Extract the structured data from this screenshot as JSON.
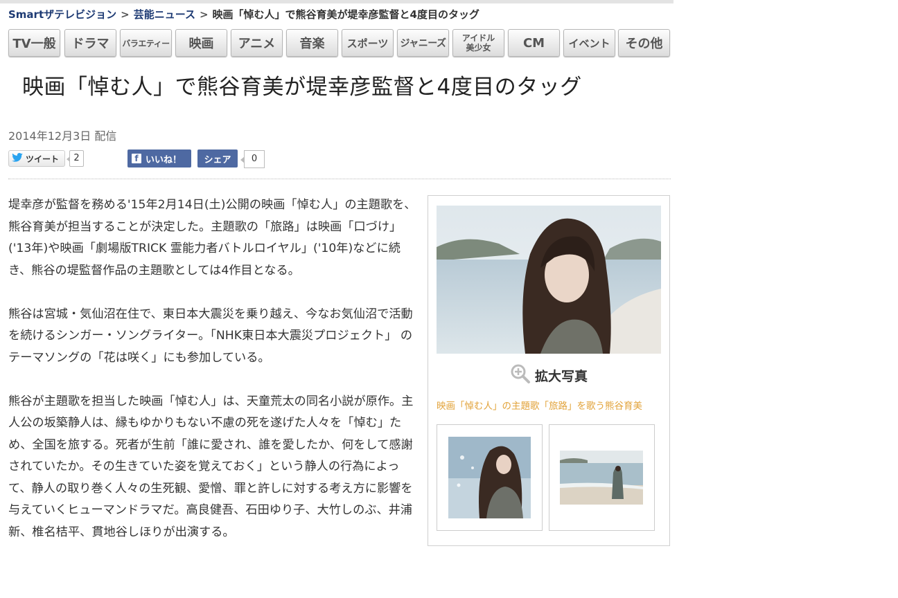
{
  "breadcrumb": {
    "site": "Smartザテレビジョン",
    "separator": ">",
    "category": "芸能ニュース",
    "current": "映画「悼む人」で熊谷育美が堤幸彦監督と4度目のタッグ"
  },
  "nav": {
    "items": [
      {
        "label": "TV一般"
      },
      {
        "label": "ドラマ"
      },
      {
        "label": "バラエティー"
      },
      {
        "label": "映画"
      },
      {
        "label": "アニメ"
      },
      {
        "label": "音楽"
      },
      {
        "label": "スポーツ"
      },
      {
        "label": "ジャニーズ"
      },
      {
        "label_line1": "アイドル",
        "label_line2": "美少女"
      },
      {
        "label": "CM"
      },
      {
        "label": "イベント"
      },
      {
        "label": "その他"
      }
    ]
  },
  "article": {
    "title": "映画「悼む人」で熊谷育美が堤幸彦監督と4度目のタッグ",
    "date": "2014年12月3日 配信",
    "paragraphs": [
      "堤幸彦が監督を務める'15年2月14日(土)公開の映画「悼む人」の主題歌を、熊谷育美が担当することが決定した。主題歌の「旅路」は映画「口づけ」('13年)や映画「劇場版TRICK 霊能力者バトルロイヤル」('10年)などに続き、熊谷の堤監督作品の主題歌としては4作目となる。",
      "熊谷は宮城・気仙沼在住で、東日本大震災を乗り越え、今なお気仙沼で活動を続けるシンガー・ソングライター。「NHK東日本大震災プロジェクト」 のテーマソングの「花は咲く」にも参加している。",
      "熊谷が主題歌を担当した映画「悼む人」は、天童荒太の同名小説が原作。主人公の坂築静人は、縁もゆかりもない不慮の死を遂げた人々を「悼む」ため、全国を旅する。死者が生前「誰に愛され、誰を愛したか、何をして感謝されていたか。その生きていた姿を覚えておく」という静人の行為によって、静人の取り巻く人々の生死観、愛憎、罪と許しに対する考え方に影響を与えていくヒューマンドラマだ。高良健吾、石田ゆり子、大竹しのぶ、井浦新、椎名桔平、貫地谷しほりが出演する。"
    ]
  },
  "social": {
    "tweet_label": "ツイート",
    "tweet_count": "2",
    "like_label": "いいね！",
    "share_label": "シェア",
    "share_count": "0"
  },
  "sidebar": {
    "zoom_label": "拡大写真",
    "caption": "映画「悼む人」の主題歌「旅路」を歌う熊谷育美"
  },
  "colors": {
    "breadcrumb_link": "#1d3a73",
    "caption": "#e2a33a",
    "facebook": "#4e69a2"
  }
}
